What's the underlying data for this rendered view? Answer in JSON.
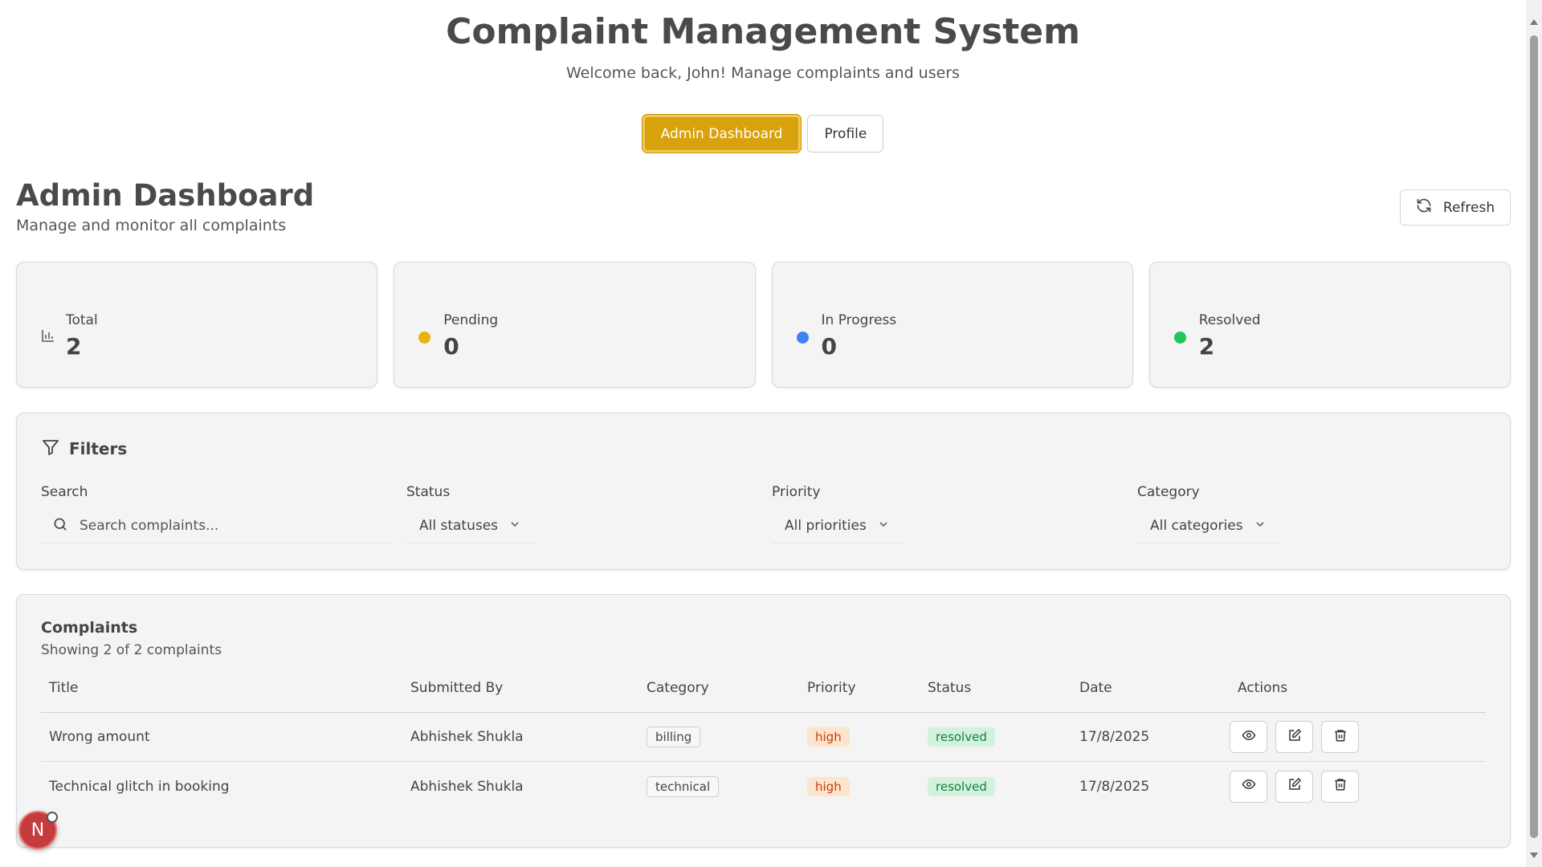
{
  "header": {
    "title": "Complaint Management System",
    "subtitle": "Welcome back, John! Manage complaints and users"
  },
  "nav": {
    "tabs": [
      {
        "label": "Admin Dashboard",
        "active": true
      },
      {
        "label": "Profile",
        "active": false
      }
    ]
  },
  "dashboard": {
    "title": "Admin Dashboard",
    "subtitle": "Manage and monitor all complaints",
    "refresh_label": "Refresh"
  },
  "stats": [
    {
      "label": "Total",
      "value": "2",
      "icon": "bar-chart-icon",
      "color": "#555555"
    },
    {
      "label": "Pending",
      "value": "0",
      "icon": "pending-dot",
      "color": "#eab308"
    },
    {
      "label": "In Progress",
      "value": "0",
      "icon": "in-progress-dot",
      "color": "#3b82f6"
    },
    {
      "label": "Resolved",
      "value": "2",
      "icon": "resolved-dot",
      "color": "#22c55e"
    }
  ],
  "filters": {
    "title": "Filters",
    "search": {
      "label": "Search",
      "placeholder": "Search complaints..."
    },
    "status": {
      "label": "Status",
      "value": "All statuses"
    },
    "priority": {
      "label": "Priority",
      "value": "All priorities"
    },
    "category": {
      "label": "Category",
      "value": "All categories"
    }
  },
  "complaints": {
    "title": "Complaints",
    "subtitle": "Showing 2 of 2 complaints",
    "columns": [
      "Title",
      "Submitted By",
      "Category",
      "Priority",
      "Status",
      "Date",
      "Actions"
    ],
    "rows": [
      {
        "title": "Wrong amount",
        "submitted_by": "Abhishek Shukla",
        "category": "billing",
        "priority": "high",
        "status": "resolved",
        "date": "17/8/2025"
      },
      {
        "title": "Technical glitch in booking",
        "submitted_by": "Abhishek Shukla",
        "category": "technical",
        "priority": "high",
        "status": "resolved",
        "date": "17/8/2025"
      }
    ]
  },
  "dev_badge": {
    "letter": "N"
  },
  "colors": {
    "accent": "#d8a20f",
    "priority_high_bg": "#fde4cc",
    "status_resolved_bg": "#d3f2dd"
  }
}
